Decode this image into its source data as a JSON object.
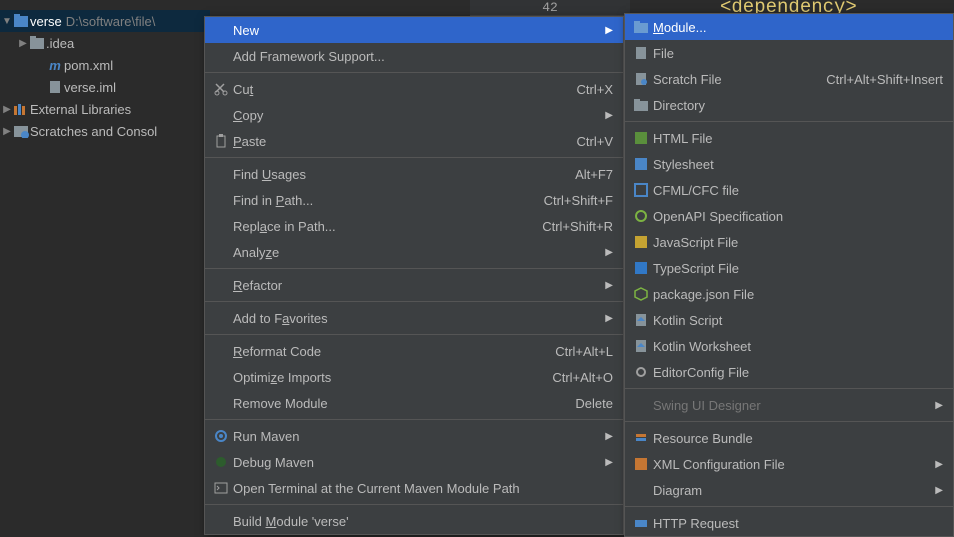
{
  "editor": {
    "line_number": "42",
    "text_fragment": "<dependency>"
  },
  "tree": {
    "root": {
      "label": "verse",
      "path": "D:\\software\\file\\"
    },
    "idea": ".idea",
    "pom": "pom.xml",
    "iml": "verse.iml",
    "ext": "External Libraries",
    "scratch": "Scratches and Consol"
  },
  "ctx1": {
    "new": "New",
    "framework": "Add Framework Support...",
    "cut": "Cut",
    "cut_sc": "Ctrl+X",
    "copy": "Copy",
    "paste": "Paste",
    "paste_sc": "Ctrl+V",
    "usages": "Find Usages",
    "usages_sc": "Alt+F7",
    "findpath": "Find in Path...",
    "findpath_sc": "Ctrl+Shift+F",
    "replpath": "Replace in Path...",
    "replpath_sc": "Ctrl+Shift+R",
    "analyze": "Analyze",
    "refactor": "Refactor",
    "fav": "Add to Favorites",
    "reformat": "Reformat Code",
    "reformat_sc": "Ctrl+Alt+L",
    "optimize": "Optimize Imports",
    "optimize_sc": "Ctrl+Alt+O",
    "remmod": "Remove Module",
    "remmod_sc": "Delete",
    "runmvn": "Run Maven",
    "dbgmvn": "Debug Maven",
    "term": "Open Terminal at the Current Maven Module Path",
    "buildmod": "Build Module 'verse'"
  },
  "ctx2": {
    "module": "Module...",
    "file": "File",
    "scratch": "Scratch File",
    "scratch_sc": "Ctrl+Alt+Shift+Insert",
    "dir": "Directory",
    "html": "HTML File",
    "css": "Stylesheet",
    "cfml": "CFML/CFC file",
    "openapi": "OpenAPI Specification",
    "js": "JavaScript File",
    "ts": "TypeScript File",
    "pkgjson": "package.json File",
    "kts": "Kotlin Script",
    "ktw": "Kotlin Worksheet",
    "editorcfg": "EditorConfig File",
    "swing": "Swing UI Designer",
    "resbundle": "Resource Bundle",
    "xmlcfg": "XML Configuration File",
    "diagram": "Diagram",
    "httpreq": "HTTP Request"
  }
}
